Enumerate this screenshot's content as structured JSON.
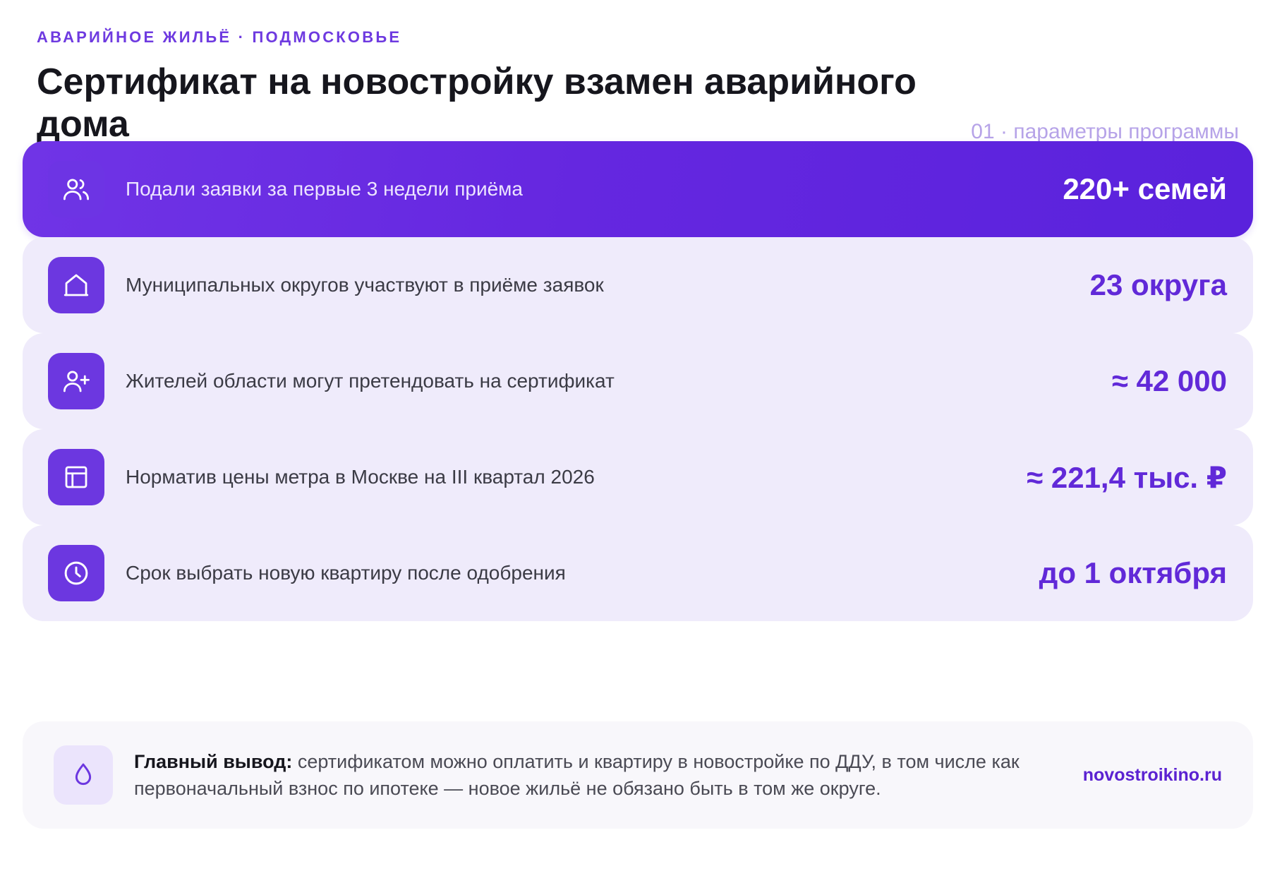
{
  "header": {
    "eyebrow": "АВАРИЙНОЕ ЖИЛЬЁ · ПОДМОСКОВЬЕ",
    "title": "Сертификат на новостройку взамен аварийного дома",
    "section_tag": "01 · параметры программы"
  },
  "accent_color": "#6129d8",
  "hero_gradient": [
    "#7034e6",
    "#5a22dc"
  ],
  "stats": [
    {
      "icon": "users-icon",
      "label": "Подали заявки за первые 3 недели приёма",
      "value": "220+ семей"
    },
    {
      "icon": "home-icon",
      "label": "Муниципальных округов участвуют в приёме заявок",
      "value": "23 округа"
    },
    {
      "icon": "user-plus-icon",
      "label": "Жителей области могут претендовать на сертификат",
      "value": "≈ 42 000"
    },
    {
      "icon": "layout-icon",
      "label": "Норматив цены метра в Москве на III квартал 2026",
      "value": "≈ 221,4 тыс. ₽"
    },
    {
      "icon": "clock-icon",
      "label": "Срок выбрать новую квартиру после одобрения",
      "value": "до 1 октября"
    }
  ],
  "summary": {
    "icon": "drop-icon",
    "bold": "Главный вывод:",
    "text": " сертификатом можно оплатить и квартиру в новостройке по ДДУ, в том числе как первоначальный взнос по ипотеке — новое жильё не обязано быть в том же округе.",
    "site": "novostroikino.ru"
  }
}
